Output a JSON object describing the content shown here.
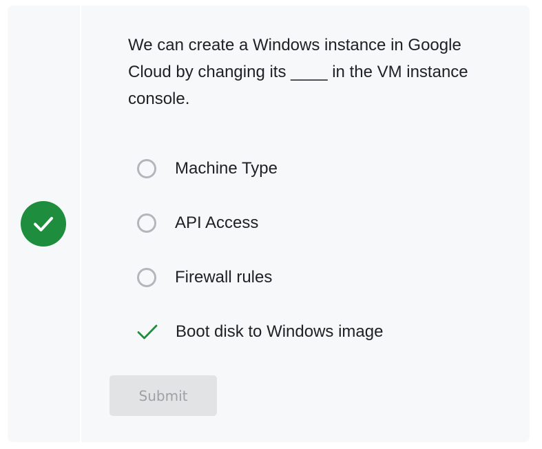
{
  "status": {
    "icon": "checkmark-icon",
    "color": "#1e8e3e"
  },
  "question": {
    "text": "We can create a Windows instance in Google Cloud by changing its ____ in the VM instance console."
  },
  "options": [
    {
      "label": "Machine Type",
      "state": "unselected"
    },
    {
      "label": "API Access",
      "state": "unselected"
    },
    {
      "label": "Firewall rules",
      "state": "unselected"
    },
    {
      "label": "Boot disk to Windows image",
      "state": "correct"
    }
  ],
  "submit": {
    "label": "Submit",
    "disabled": true
  }
}
